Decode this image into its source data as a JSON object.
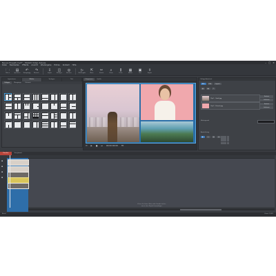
{
  "window": {
    "title": "Neues Projekt.mvd* – MAGIX Video deluxe"
  },
  "menu": [
    "Datei",
    "Bearbeiten",
    "Effekte",
    "Ansicht",
    "Wiedergabe",
    "Extras",
    "Kontext",
    "Hilfe"
  ],
  "toolbar": [
    {
      "icon": "folder-icon",
      "glyph": "🗀",
      "label": "Öffnen"
    },
    {
      "icon": "save-icon",
      "glyph": "▤",
      "label": "Speichern"
    },
    {
      "icon": "undo-icon",
      "glyph": "↶",
      "label": "Rückgängig"
    },
    {
      "icon": "redo-icon",
      "glyph": "↷",
      "label": "Wiederh."
    },
    {
      "icon": "import-icon",
      "glyph": "⇩",
      "label": "Import"
    },
    {
      "icon": "insert-icon",
      "glyph": "◫",
      "label": "Einfügen"
    },
    {
      "icon": "disc-icon",
      "glyph": "◎",
      "label": "Brennen"
    },
    {
      "icon": "play-icon",
      "glyph": "▷",
      "label": "Wiedergabe"
    },
    {
      "icon": "cursor-icon",
      "glyph": "⇱",
      "label": "Maus"
    },
    {
      "icon": "cut-icon",
      "glyph": "✂",
      "label": "Schnitt"
    },
    {
      "icon": "zoom-icon",
      "glyph": "⌕",
      "label": "Zoom"
    },
    {
      "icon": "split-icon",
      "glyph": "⫼",
      "label": "Teilen"
    },
    {
      "icon": "effects-icon",
      "glyph": "▦",
      "label": "Effekte"
    },
    {
      "icon": "title-icon",
      "glyph": "▣",
      "label": "Titel"
    },
    {
      "icon": "export-icon",
      "glyph": "⇪",
      "label": "Export"
    }
  ],
  "left_panel": {
    "tabs": [
      "Importieren",
      "Effekte",
      "Vorlagen",
      "Titel"
    ],
    "subtabs": [
      "Collagen",
      "Übergänge",
      "Filmlook"
    ]
  },
  "preview": {
    "tabs": [
      "Programm",
      "Quelle"
    ],
    "timecode": "00:00:00:00",
    "fit": "Fit"
  },
  "right_panel": {
    "header": "Collage-Assistent",
    "mode_buttons": [
      "Alle",
      "Bild",
      "Layout"
    ],
    "clips": [
      {
        "name": "Clip 1 – Stadt.jpg"
      },
      {
        "name": "Clip 2 – Portrait.jpg"
      }
    ],
    "clip_buttons": [
      "Ersetzen",
      "Entfernen"
    ],
    "labels": {
      "background": "Hintergrund",
      "alignment": "Ausrichtung"
    }
  },
  "timeline": {
    "tabs": [
      "Timeline",
      "Storyboard"
    ],
    "hint_line1": "Ziehen Sie Fotos, Videos oder Sounds hierher,",
    "hint_line2": "um sie dem Projekt hinzuzufügen."
  },
  "status": {
    "left": "Bereit",
    "right": "Zoom: 100%"
  }
}
